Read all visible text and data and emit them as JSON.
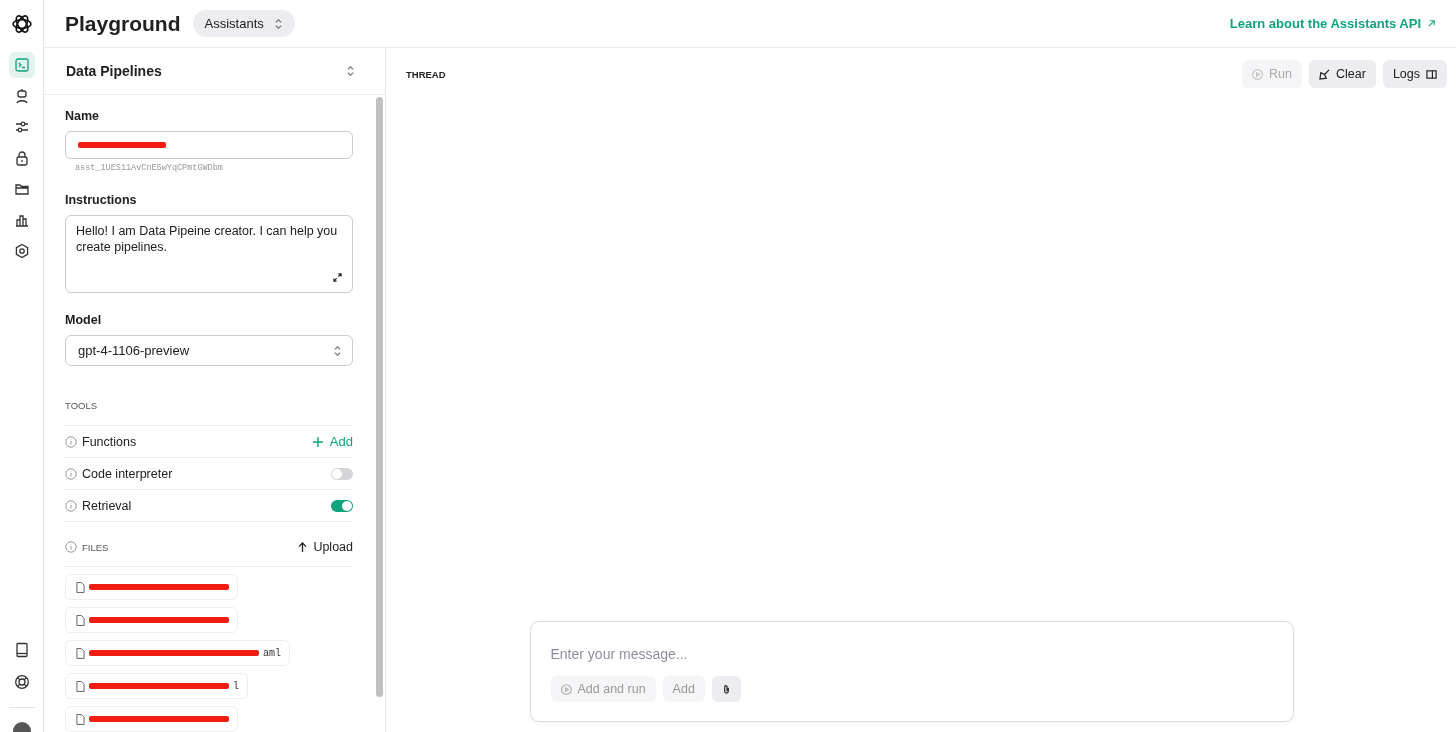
{
  "header": {
    "title": "Playground",
    "mode_select": "Assistants",
    "link": "Learn about the Assistants API"
  },
  "nav": [
    {
      "kind": "terminal",
      "selected": true
    },
    {
      "kind": "robot",
      "selected": false
    },
    {
      "kind": "sliders",
      "selected": false
    },
    {
      "kind": "lock",
      "selected": false
    },
    {
      "kind": "folder",
      "selected": false
    },
    {
      "kind": "chart",
      "selected": false
    },
    {
      "kind": "gear",
      "selected": false
    }
  ],
  "nav_bottom": [
    {
      "kind": "book"
    },
    {
      "kind": "lifebuoy"
    }
  ],
  "assistant": {
    "selector": "Data Pipelines",
    "name_label": "Name",
    "name_value": {
      "kind": "redacted"
    },
    "assistant_id": "asst_1UES11AvCnE5wYqCPmtGWDbm",
    "instructions_label": "Instructions",
    "instructions": "Hello! I am Data Pipeine creator. I can help you create pipelines.",
    "model_label": "Model",
    "model": "gpt-4-1106-preview"
  },
  "tools": {
    "heading": "TOOLS",
    "items": [
      {
        "kind": "add",
        "label": "Functions",
        "action": "Add"
      },
      {
        "kind": "toggle",
        "label": "Code interpreter",
        "on": false
      },
      {
        "kind": "toggle",
        "label": "Retrieval",
        "on": true
      }
    ]
  },
  "files": {
    "heading": "FILES",
    "upload": "Upload",
    "items": [
      {
        "kind": "redacted"
      },
      {
        "kind": "redacted"
      },
      {
        "kind": "redacted",
        "tail": "aml"
      },
      {
        "kind": "redacted",
        "tail": "l"
      },
      {
        "kind": "redacted"
      }
    ]
  },
  "thread": {
    "heading": "THREAD",
    "buttons": [
      {
        "label": "Run",
        "kind": "run",
        "disabled": true
      },
      {
        "label": "Clear",
        "kind": "clear",
        "disabled": false
      },
      {
        "label": "Logs",
        "kind": "logs",
        "disabled": false
      }
    ]
  },
  "composer": {
    "placeholder": "Enter your message...",
    "add_and_run": "Add and run",
    "add": "Add"
  }
}
